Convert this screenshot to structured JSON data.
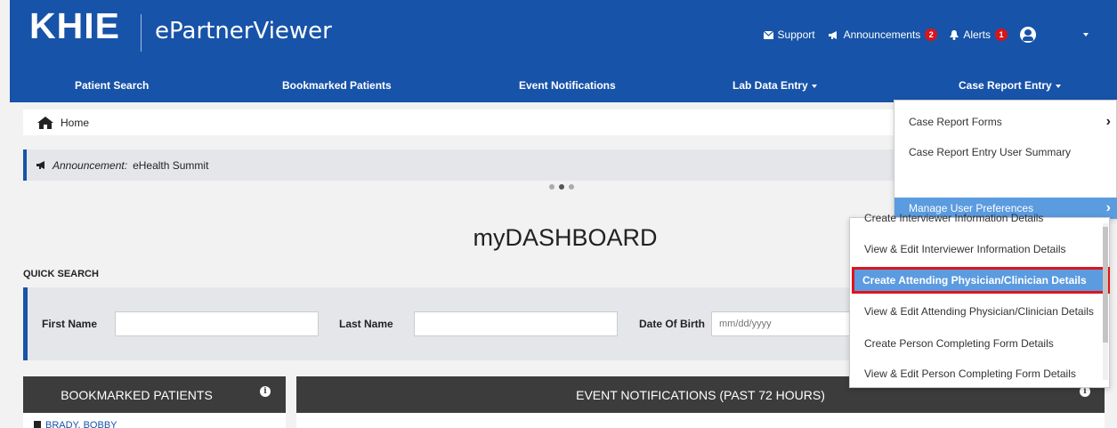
{
  "header": {
    "logo": "KHIE",
    "app_title": "ePartnerViewer",
    "support_label": "Support",
    "announcements_label": "Announcements",
    "announcements_count": "2",
    "alerts_label": "Alerts",
    "alerts_count": "1"
  },
  "mainnav": {
    "items": [
      {
        "label": "Patient Search"
      },
      {
        "label": "Bookmarked Patients"
      },
      {
        "label": "Event Notifications"
      },
      {
        "label": "Lab Data Entry"
      },
      {
        "label": "Case Report Entry"
      }
    ]
  },
  "breadcrumb": {
    "home_label": "Home"
  },
  "announcement": {
    "prefix": "Announcement:",
    "text": "eHealth Summit"
  },
  "dashboard": {
    "title": "myDASHBOARD"
  },
  "quick_search": {
    "label": "QUICK SEARCH",
    "first_name_label": "First Name",
    "first_name_value": "",
    "last_name_label": "Last Name",
    "last_name_value": "",
    "dob_label": "Date Of Birth",
    "dob_placeholder": "mm/dd/yyyy"
  },
  "panels": {
    "bookmarked_title": "BOOKMARKED PATIENTS",
    "events_title": "EVENT NOTIFICATIONS (PAST 72 HOURS)",
    "bookmark_first": "BRADY, BOBBY"
  },
  "dropdown": {
    "items": [
      {
        "label": "Case Report Forms"
      },
      {
        "label": "Case Report Entry User Summary"
      },
      {
        "label": "Manage User Preferences"
      }
    ]
  },
  "submenu": {
    "items": [
      {
        "label": "Create Interviewer Information Details"
      },
      {
        "label": "View & Edit Interviewer Information Details"
      },
      {
        "label": "Create Attending Physician/Clinician Details"
      },
      {
        "label": "View & Edit Attending Physician/Clinician Details"
      },
      {
        "label": "Create Person Completing Form Details"
      },
      {
        "label": "View & Edit Person Completing Form Details"
      }
    ]
  },
  "colors": {
    "brand_blue": "#1753a8",
    "highlight_blue": "#5b9be0",
    "badge_red": "#d8141c",
    "callout_red": "#e0141b"
  }
}
